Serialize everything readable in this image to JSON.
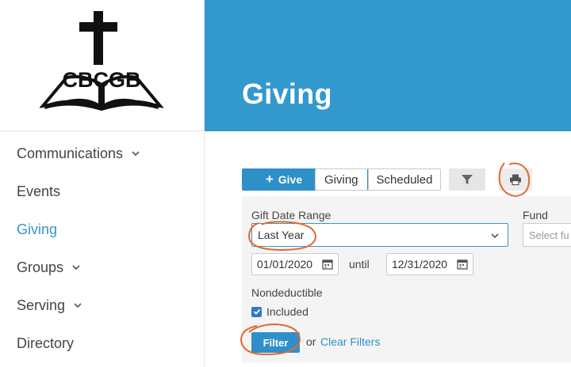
{
  "logo": {
    "text": "CBCGB"
  },
  "nav": {
    "items": [
      {
        "label": "Communications",
        "has_chevron": true,
        "active": false
      },
      {
        "label": "Events",
        "has_chevron": false,
        "active": false
      },
      {
        "label": "Giving",
        "has_chevron": false,
        "active": true
      },
      {
        "label": "Groups",
        "has_chevron": true,
        "active": false
      },
      {
        "label": "Serving",
        "has_chevron": true,
        "active": false
      },
      {
        "label": "Directory",
        "has_chevron": false,
        "active": false
      }
    ]
  },
  "header": {
    "title": "Giving"
  },
  "toolbar": {
    "give_label": "Give",
    "tabs": [
      {
        "label": "Giving",
        "active": true
      },
      {
        "label": "Scheduled",
        "active": false
      }
    ],
    "filter_icon": "funnel-icon",
    "print_icon": "printer-icon"
  },
  "filters": {
    "gift_date_range_label": "Gift Date Range",
    "gift_date_range_value": "Last Year",
    "fund_label": "Fund",
    "fund_placeholder": "Select fu",
    "start_date": "01/01/2020",
    "until_label": "until",
    "end_date": "12/31/2020",
    "nondeductible_label": "Nondeductible",
    "included_label": "Included",
    "included_checked": true,
    "filter_button": "Filter",
    "or_text": "or",
    "clear_filters": "Clear Filters"
  },
  "colors": {
    "header_bg": "#3399cc",
    "primary": "#2f8fc9",
    "active_nav": "#3a93c6",
    "annotation": "#e06a2c"
  }
}
